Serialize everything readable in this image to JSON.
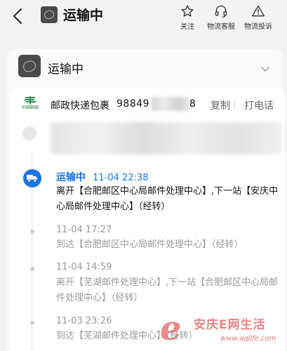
{
  "header": {
    "title": "运输中",
    "back_icon": "chevron-left-icon",
    "actions": [
      {
        "label": "关注",
        "icon": "star-icon"
      },
      {
        "label": "物流客服",
        "icon": "headset-icon"
      },
      {
        "label": "物流投诉",
        "icon": "warning-icon"
      }
    ]
  },
  "card": {
    "status": "运输中",
    "carrier": {
      "name": "邮政快递包裹",
      "tracking_prefix": "98849",
      "tracking_suffix": "8",
      "logo_text": "中国邮政",
      "copy_label": "复制",
      "call_label": "打电话"
    },
    "events": [
      {
        "status": "运输中",
        "time": "11-04 22:38",
        "text": "离开【合肥邮区中心局邮件处理中心】,下一站【安庆中心局邮件处理中心】（经转）"
      },
      {
        "time": "11-04 17:27",
        "text": "到达【合肥邮区中心局邮件处理中心】（经转）"
      },
      {
        "time": "11-04 14:59",
        "text": "离开【芜湖邮件处理中心】,下一站【合肥邮区中心局邮件处理中心】（经转）"
      },
      {
        "time": "11-03 23:26",
        "text": "到达【芜湖邮件处理中心】（经转）"
      }
    ]
  },
  "watermark": {
    "letter": "e",
    "text": "安庆E网生活",
    "url": "www.aqlife.com"
  },
  "colors": {
    "accent": "#1a73e8",
    "background": "#f3f3f3",
    "muted_text": "#9a9a9a"
  }
}
